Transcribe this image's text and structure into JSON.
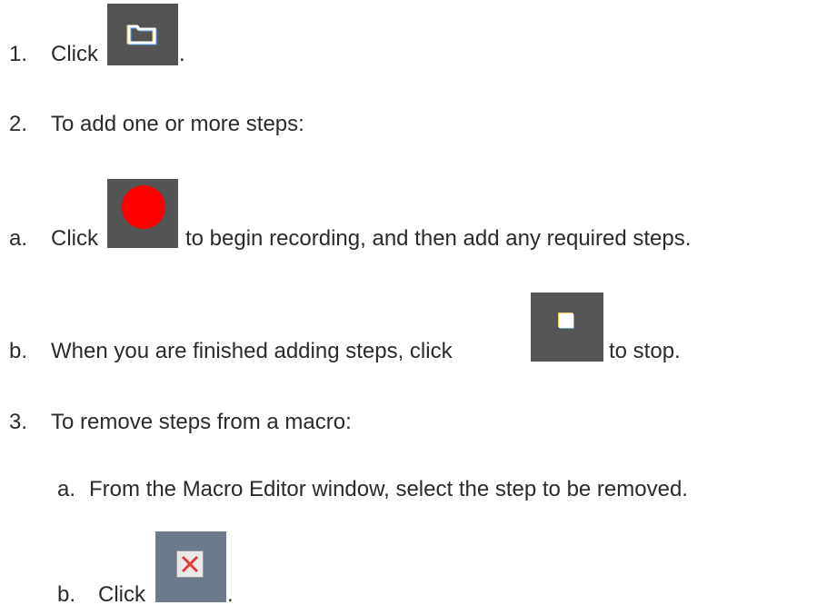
{
  "steps": [
    {
      "marker": "1.",
      "before": "Click",
      "after": "."
    },
    {
      "marker": "2.",
      "text": "To add one or more steps:"
    },
    {
      "marker": "a.",
      "before": "Click",
      "after": "to begin recording, and then add any required steps."
    },
    {
      "marker": "b.",
      "before": "When you are finished adding steps, click",
      "after": "to stop."
    },
    {
      "marker": "3.",
      "text": "To remove steps from a macro:"
    },
    {
      "marker": "a.",
      "text": "From the Macro Editor window, select the step to be removed."
    },
    {
      "marker": "b.",
      "before": "Click",
      "after": "."
    }
  ],
  "icons": {
    "folder": "folder-icon",
    "record": "record-icon",
    "stop": "stop-icon",
    "remove": "remove-step-icon"
  },
  "colors": {
    "text": "#2b2b2b",
    "button_bg": "#555555",
    "record": "#ff0000",
    "remove_bg": "#6c7a8c",
    "remove_x": "#e23b3b"
  }
}
